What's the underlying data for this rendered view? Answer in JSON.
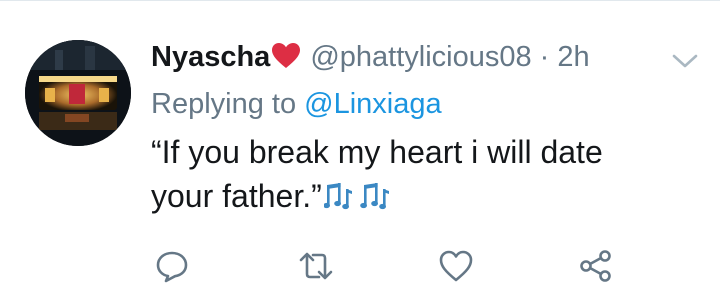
{
  "tweet": {
    "author_name": "Nyascha",
    "handle": "@phattylicious08",
    "separator": "·",
    "time": "2h",
    "replying_prefix": "Replying to",
    "replying_to": "@Linxiaga",
    "text": "“If you break my heart i will date your father.”",
    "emoji_after_name": "red-heart",
    "emoji_in_text": "musical-notes"
  },
  "icons": {
    "menu": "chevron-down-icon",
    "reply": "reply-icon",
    "retweet": "retweet-icon",
    "like": "heart-outline-icon",
    "share": "share-icon"
  },
  "colors": {
    "text": "#14171a",
    "secondary": "#657786",
    "link": "#1b95e0",
    "heart": "#e0245e"
  }
}
